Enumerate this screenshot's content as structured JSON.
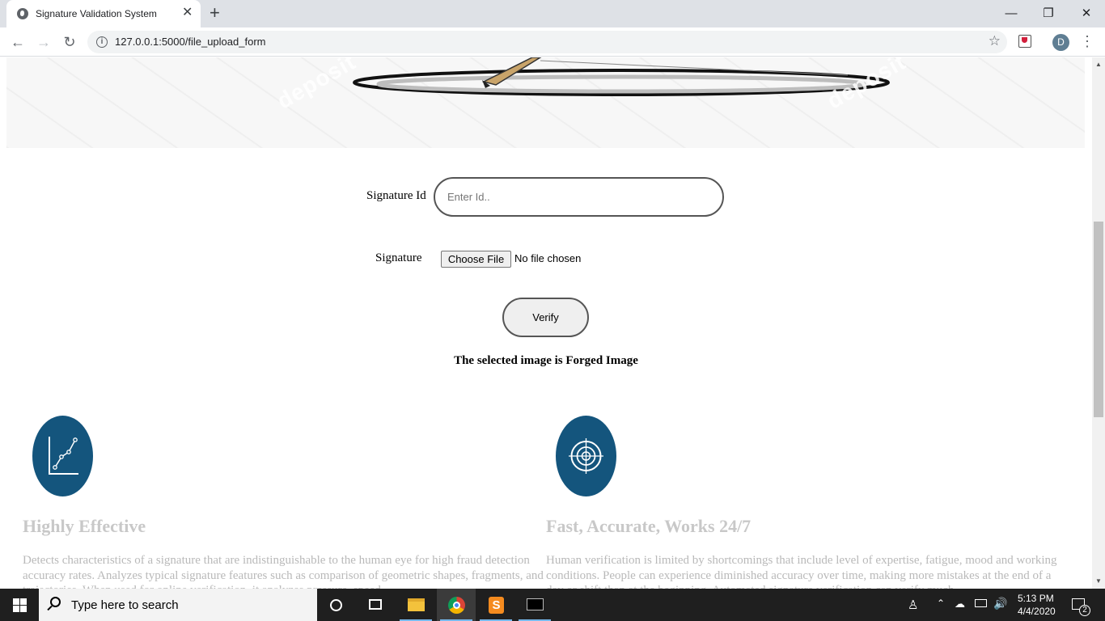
{
  "browser": {
    "tab_title": "Signature Validation System",
    "url": "127.0.0.1:5000/file_upload_form",
    "profile_initial": "D"
  },
  "form": {
    "id_label": "Signature Id",
    "id_placeholder": "Enter Id..",
    "signature_label": "Signature",
    "choose_file_label": "Choose File",
    "file_status": "No file chosen",
    "verify_label": "Verify",
    "result_text": "The selected image is Forged Image"
  },
  "features": [
    {
      "icon": "chart-line-icon",
      "title": "Highly Effective",
      "text": "Detects characteristics of a signature that are indistinguishable to the human eye for high fraud detection accuracy rates. Analyzes typical signature features such as comparison of geometric shapes, fragments, and trajectories. When used for online verification, it analyzes pressure, speed"
    },
    {
      "icon": "target-icon",
      "title": "Fast, Accurate, Works 24/7",
      "text": "Human verification is limited by shortcomings that include level of expertise, fatigue, mood and working conditions. People can experience diminished accuracy over time, making more mistakes at the end of a day or shift than at the beginning. Automated signature verification can verify much"
    }
  ],
  "hero": {
    "watermarks": [
      "deposit",
      "deposit"
    ]
  },
  "taskbar": {
    "search_placeholder": "Type here to search",
    "time": "5:13 PM",
    "date": "4/4/2020",
    "notification_count": "2"
  },
  "colors": {
    "feature_icon_bg": "#14557d",
    "feature_heading": "#c8c8c8",
    "feature_text": "#b9b9b9"
  }
}
